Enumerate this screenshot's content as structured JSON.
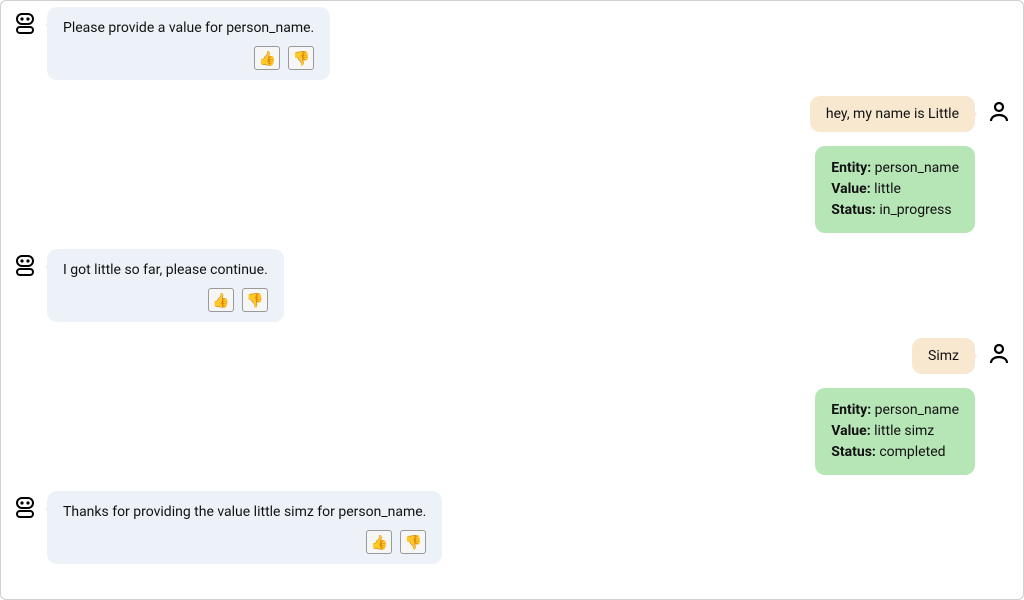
{
  "bot": {
    "msg1": "Please provide a value for person_name.",
    "msg2": "I got little so far, please continue.",
    "msg3": "Thanks for providing the value little simz for person_name."
  },
  "user": {
    "msg1": "hey, my name is Little",
    "msg2": "Simz"
  },
  "entity1": {
    "entity_label": "Entity:",
    "entity_value": "person_name",
    "value_label": "Value:",
    "value_value": "little",
    "status_label": "Status:",
    "status_value": "in_progress"
  },
  "entity2": {
    "entity_label": "Entity:",
    "entity_value": "person_name",
    "value_label": "Value:",
    "value_value": "little simz",
    "status_label": "Status:",
    "status_value": "completed"
  },
  "feedback": {
    "up": "👍",
    "down": "👎"
  }
}
